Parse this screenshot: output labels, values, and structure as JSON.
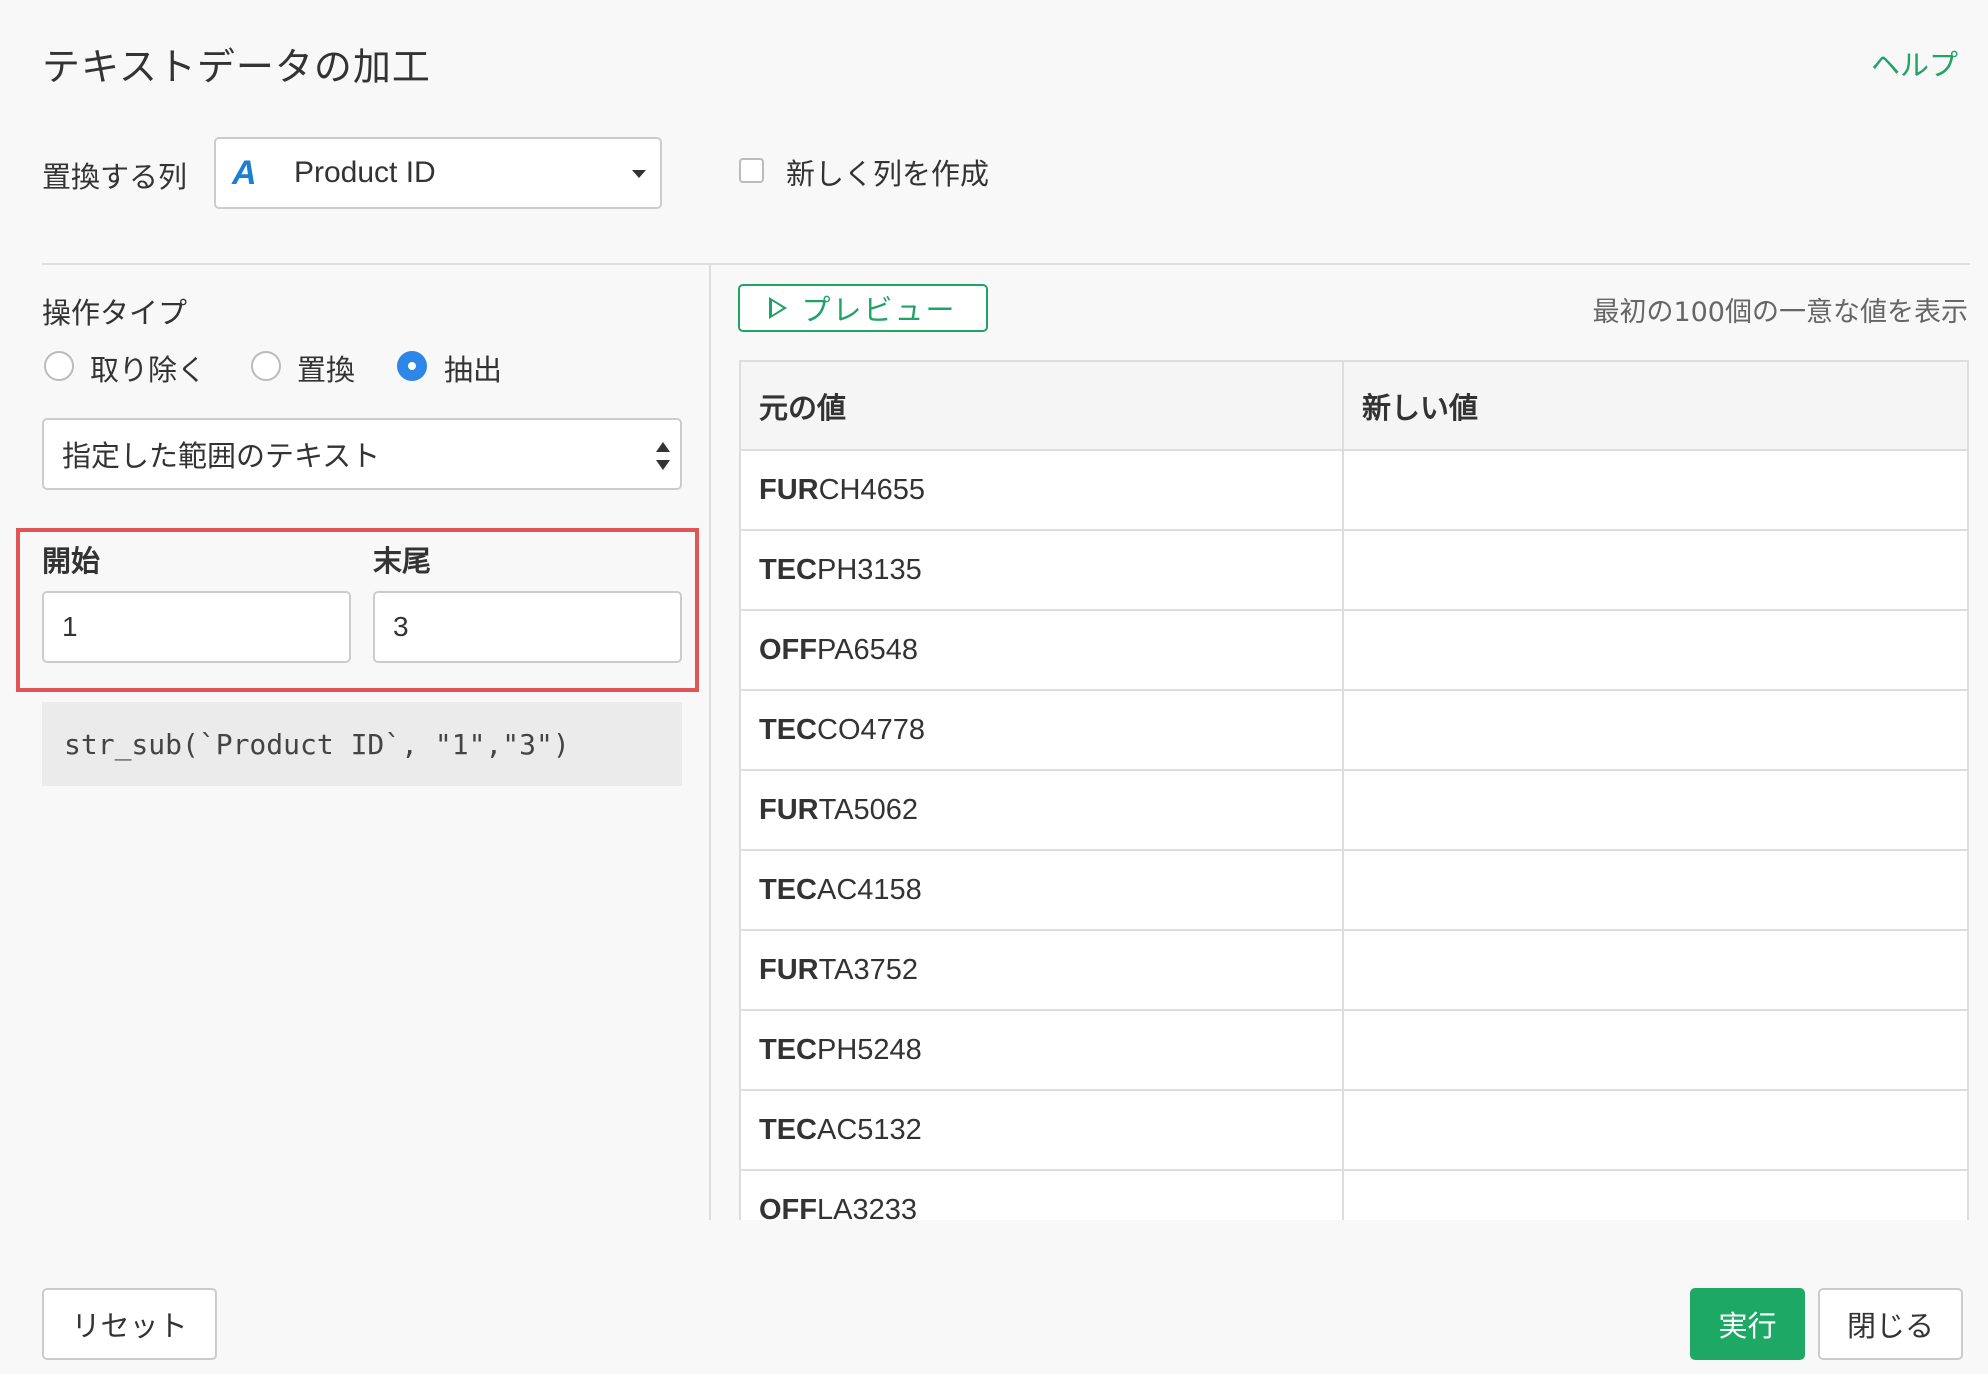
{
  "header": {
    "title": "テキストデータの加工",
    "help_label": "ヘルプ"
  },
  "column_row": {
    "label": "置換する列",
    "type_icon": "A",
    "selected_column": "Product ID",
    "new_column_checked": false,
    "new_column_label": "新しく列を作成"
  },
  "operation": {
    "label": "操作タイプ",
    "options": [
      {
        "label": "取り除く",
        "checked": false
      },
      {
        "label": "置換",
        "checked": false
      },
      {
        "label": "抽出",
        "checked": true
      }
    ],
    "mode_selected": "指定した範囲のテキスト",
    "start_label": "開始",
    "start_value": "1",
    "end_label": "末尾",
    "end_value": "3",
    "code": "str_sub(`Product ID`, \"1\",\"3\")",
    "highlight_color": "#e25555"
  },
  "preview": {
    "button_label": "プレビュー",
    "note": "最初の100個の一意な値を表示",
    "columns": [
      "元の値",
      "新しい値"
    ],
    "rows": [
      {
        "bold": "FUR",
        "rest": "CH4655",
        "new": ""
      },
      {
        "bold": "TEC",
        "rest": "PH3135",
        "new": ""
      },
      {
        "bold": "OFF",
        "rest": "PA6548",
        "new": ""
      },
      {
        "bold": "TEC",
        "rest": "CO4778",
        "new": ""
      },
      {
        "bold": "FUR",
        "rest": "TA5062",
        "new": ""
      },
      {
        "bold": "TEC",
        "rest": "AC4158",
        "new": ""
      },
      {
        "bold": "FUR",
        "rest": "TA3752",
        "new": ""
      },
      {
        "bold": "TEC",
        "rest": "PH5248",
        "new": ""
      },
      {
        "bold": "TEC",
        "rest": "AC5132",
        "new": ""
      },
      {
        "bold": "OFF",
        "rest": "LA3233",
        "new": ""
      }
    ]
  },
  "footer": {
    "reset_label": "リセット",
    "run_label": "実行",
    "close_label": "閉じる"
  },
  "colors": {
    "accent": "#20a465",
    "primary_button": "#1ea866",
    "radio_checked": "#2e86e8",
    "type_icon": "#1d7fd1"
  }
}
